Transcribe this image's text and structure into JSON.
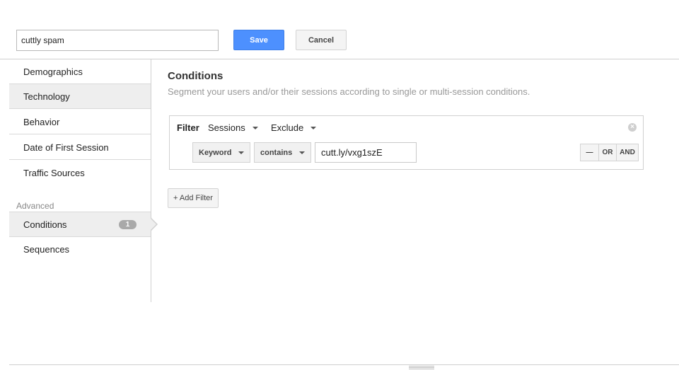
{
  "header": {
    "segment_name": "cuttly spam",
    "save_label": "Save",
    "cancel_label": "Cancel"
  },
  "sidebar": {
    "items": [
      {
        "label": "Demographics"
      },
      {
        "label": "Technology"
      },
      {
        "label": "Behavior"
      },
      {
        "label": "Date of First Session"
      },
      {
        "label": "Traffic Sources"
      }
    ],
    "advanced_heading": "Advanced",
    "advanced_items": [
      {
        "label": "Conditions",
        "badge": "1"
      },
      {
        "label": "Sequences"
      }
    ]
  },
  "main": {
    "title": "Conditions",
    "subtitle": "Segment your users and/or their sessions according to single or multi-session conditions.",
    "filter": {
      "label": "Filter",
      "scope": "Sessions",
      "mode": "Exclude",
      "dimension": "Keyword",
      "operator": "contains",
      "value": "cutt.ly/vxg1szE",
      "remove_label": "—",
      "or_label": "OR",
      "and_label": "AND"
    },
    "add_filter_label": "+ Add Filter"
  },
  "colors": {
    "accent": "#4d90fe",
    "active_row": "#eeeeee",
    "badge": "#a9a9a9"
  },
  "icons": {
    "close": "close-circle-icon",
    "dropdown": "caret-down-icon"
  }
}
